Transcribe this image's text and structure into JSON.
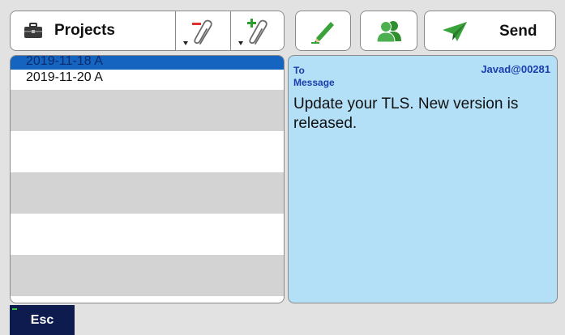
{
  "toolbar": {
    "projects_label": "Projects",
    "send_label": "Send"
  },
  "projects": [
    {
      "label": "2019-11-18 A",
      "selected": true
    },
    {
      "label": "2019-11-20 A",
      "selected": false
    }
  ],
  "message": {
    "to_label": "To",
    "recipient": "Javad@00281",
    "message_label": "Message",
    "body": "Update your TLS. New version is released."
  },
  "footer": {
    "esc_label": "Esc"
  },
  "icons": {
    "projects": "briefcase-icon",
    "remove_attachment": "remove-attachment-icon",
    "add_attachment": "add-attachment-icon",
    "edit": "pencil-icon",
    "contacts": "contact-icon",
    "send": "paper-plane-icon"
  },
  "colors": {
    "selection": "#1565c0",
    "message_bg": "#b3dff7",
    "label_blue": "#1a3fae",
    "esc_bg": "#0d1b4e",
    "remove_red": "#e03030",
    "add_green": "#2e9e2e"
  }
}
